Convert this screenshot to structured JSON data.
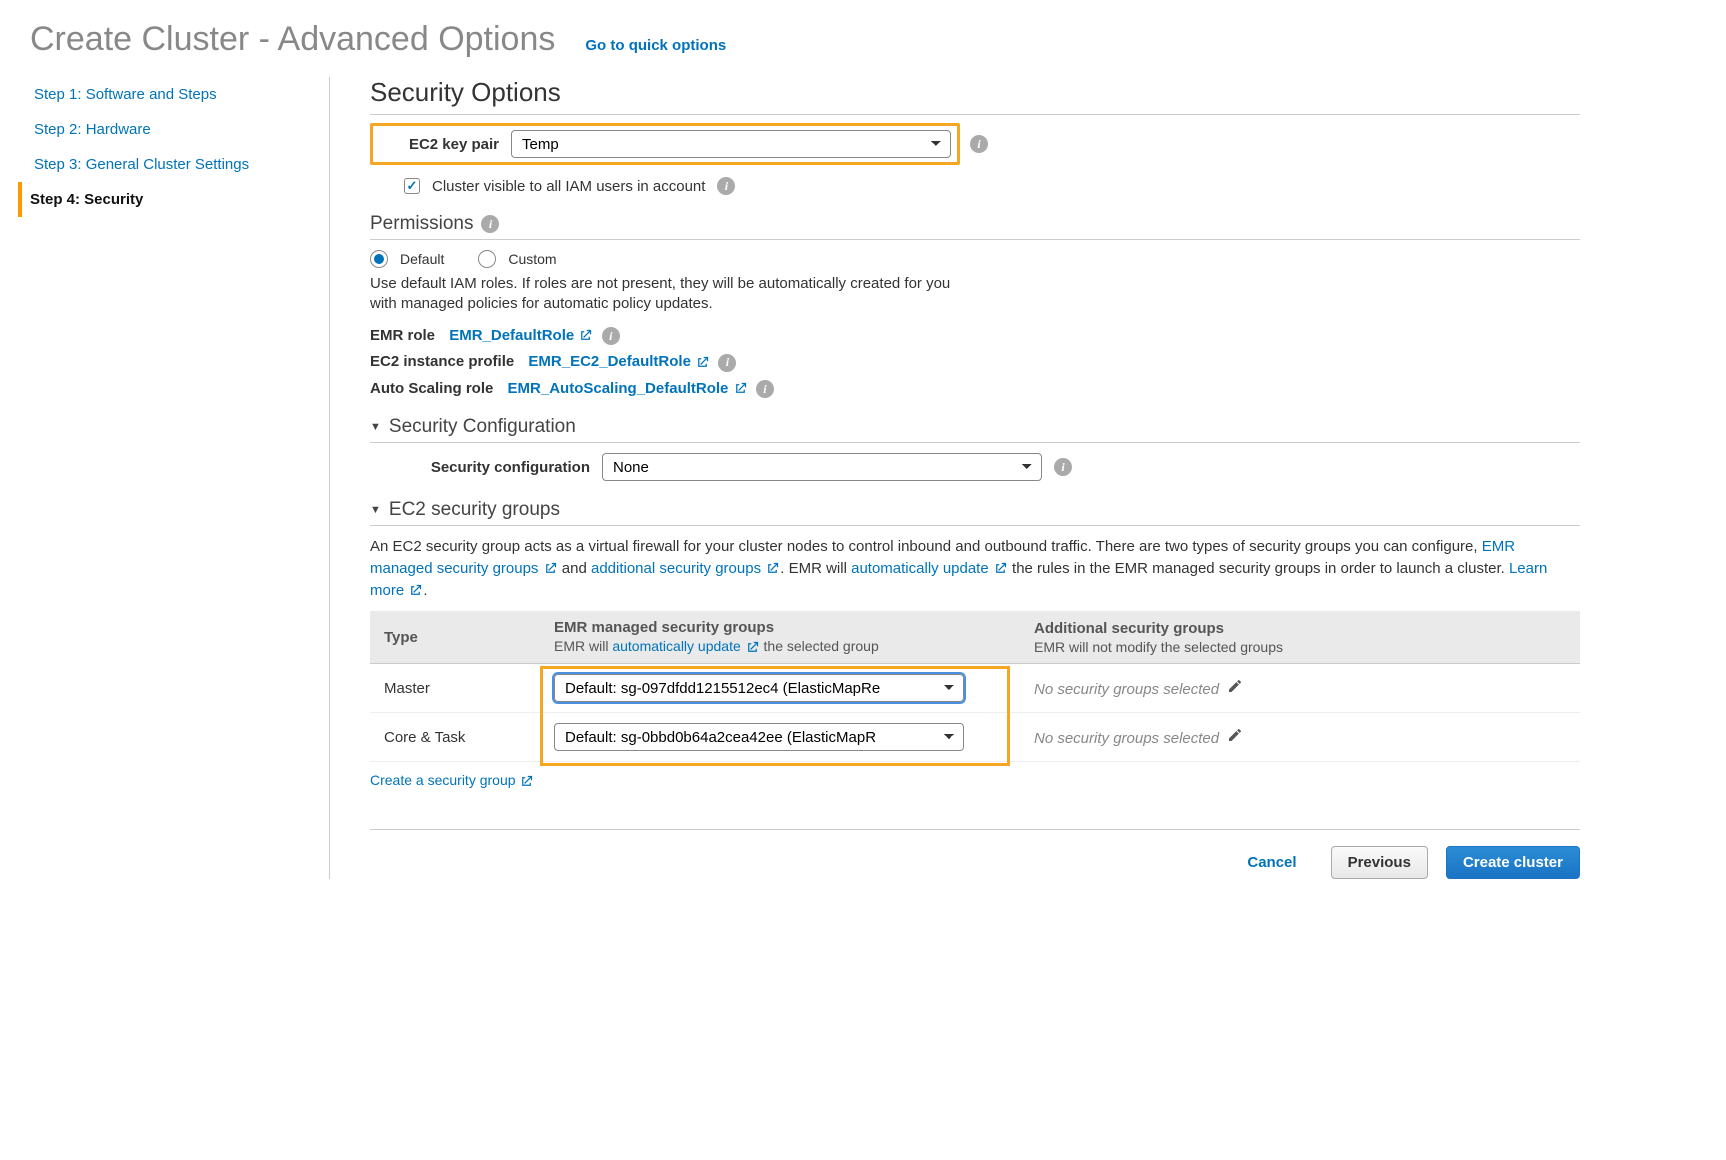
{
  "header": {
    "title": "Create Cluster - Advanced Options",
    "quick_link": "Go to quick options"
  },
  "sidebar": {
    "steps": [
      {
        "label": "Step 1: Software and Steps",
        "active": false
      },
      {
        "label": "Step 2: Hardware",
        "active": false
      },
      {
        "label": "Step 3: General Cluster Settings",
        "active": false
      },
      {
        "label": "Step 4: Security",
        "active": true
      }
    ]
  },
  "security": {
    "title": "Security Options",
    "ec2_keypair_label": "EC2 key pair",
    "ec2_keypair_value": "Temp",
    "cluster_visible_label": "Cluster visible to all IAM users in account",
    "cluster_visible_checked": true
  },
  "permissions": {
    "title": "Permissions",
    "mode_default": "Default",
    "mode_custom": "Custom",
    "description": "Use default IAM roles. If roles are not present, they will be automatically created for you with managed policies for automatic policy updates.",
    "emr_role_label": "EMR role",
    "emr_role_link": "EMR_DefaultRole",
    "ec2_profile_label": "EC2 instance profile",
    "ec2_profile_link": "EMR_EC2_DefaultRole",
    "autoscale_label": "Auto Scaling role",
    "autoscale_link": "EMR_AutoScaling_DefaultRole"
  },
  "sec_config": {
    "title": "Security Configuration",
    "label": "Security configuration",
    "value": "None"
  },
  "sg": {
    "title": "EC2 security groups",
    "desc_prefix": "An EC2 security group acts as a virtual firewall for your cluster nodes to control inbound and outbound traffic. There are two types of security groups you can configure, ",
    "link1": "EMR managed security groups",
    "mid1": " and ",
    "link2": "additional security groups",
    "mid2": ". EMR will ",
    "link3": "automatically update",
    "mid3": " the rules in the EMR managed security groups in order to launch a cluster. ",
    "learn_more": "Learn more",
    "table": {
      "col_type": "Type",
      "col_managed": "EMR managed security groups",
      "col_managed_sub_pre": "EMR will ",
      "col_managed_sub_link": "automatically update",
      "col_managed_sub_post": " the selected group",
      "col_additional": "Additional security groups",
      "col_additional_sub": "EMR will not modify the selected groups",
      "rows": [
        {
          "type": "Master",
          "managed": "Default: sg-097dfdd1215512ec4 (ElasticMapRe",
          "additional": "No security groups selected"
        },
        {
          "type": "Core & Task",
          "managed": "Default: sg-0bbd0b64a2cea42ee (ElasticMapR",
          "additional": "No security groups selected"
        }
      ]
    },
    "create_link": "Create a security group"
  },
  "footer": {
    "cancel": "Cancel",
    "previous": "Previous",
    "create": "Create cluster"
  }
}
